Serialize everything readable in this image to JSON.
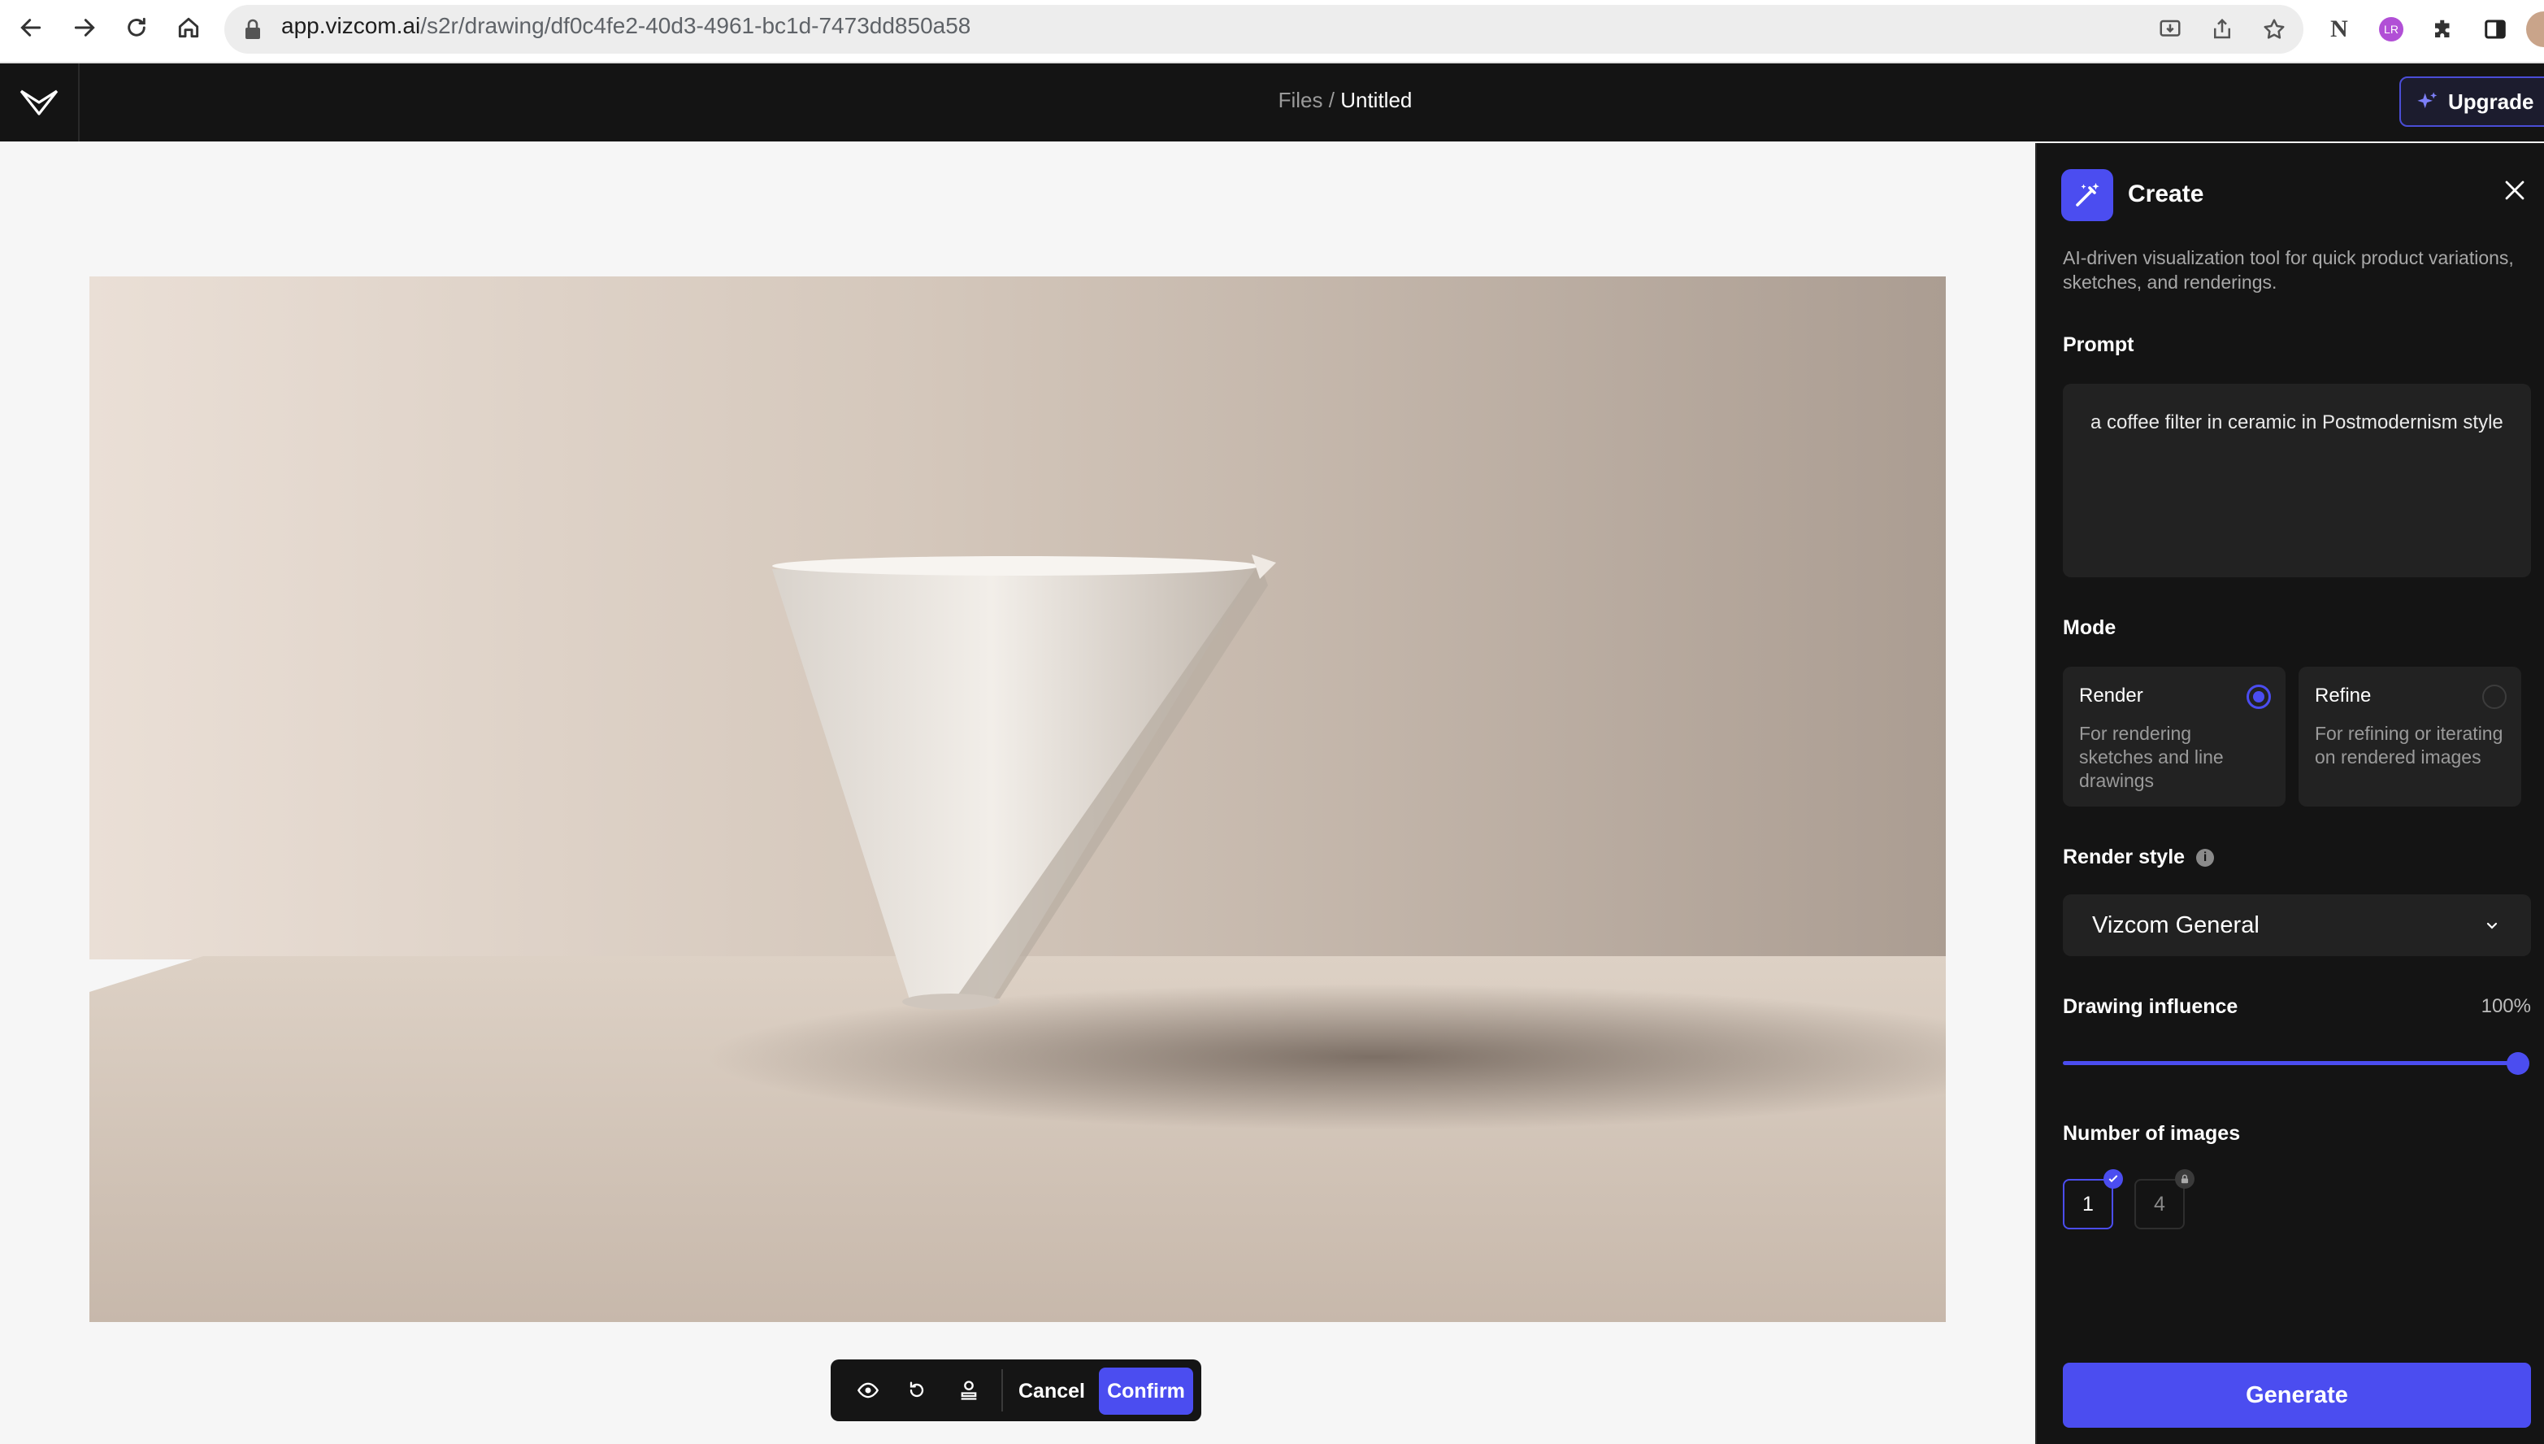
{
  "browser": {
    "url_host": "app.vizcom.ai",
    "url_path": "/s2r/drawing/df0c4fe2-40d3-4961-bc1d-7473dd850a58",
    "ext_label": "LR"
  },
  "header": {
    "crumb_parent": "Files",
    "crumb_sep": " / ",
    "crumb_current": "Untitled",
    "upgrade_label": "Upgrade"
  },
  "toolbar": {
    "cancel_label": "Cancel",
    "confirm_label": "Confirm"
  },
  "panel": {
    "title": "Create",
    "description": "AI-driven visualization tool for quick product variations, sketches, and renderings.",
    "prompt_label": "Prompt",
    "prompt_value": "a coffee filter in ceramic  in  Postmodernism style",
    "mode_label": "Mode",
    "modes": [
      {
        "title": "Render",
        "desc": "For rendering sketches and line drawings",
        "selected": true
      },
      {
        "title": "Refine",
        "desc": "For refining or iterating on rendered images",
        "selected": false
      }
    ],
    "render_style_label": "Render style",
    "render_style_value": "Vizcom General",
    "influence_label": "Drawing influence",
    "influence_value": "100%",
    "num_images_label": "Number of images",
    "num_options": [
      "1",
      "4"
    ],
    "generate_label": "Generate"
  },
  "colors": {
    "accent": "#4b4df0",
    "panel_bg": "#141414",
    "card_bg": "#222222"
  },
  "icons": [
    "back-icon",
    "forward-icon",
    "reload-icon",
    "home-icon",
    "lock-icon",
    "install-icon",
    "share-icon",
    "star-icon",
    "extensions-icon",
    "sidebar-icon",
    "logo-icon",
    "sparkle-icon",
    "magic-wand-icon",
    "close-icon",
    "eye-icon",
    "undo-icon",
    "stamp-icon",
    "info-icon",
    "chevron-down-icon",
    "check-icon",
    "lock-small-icon"
  ]
}
